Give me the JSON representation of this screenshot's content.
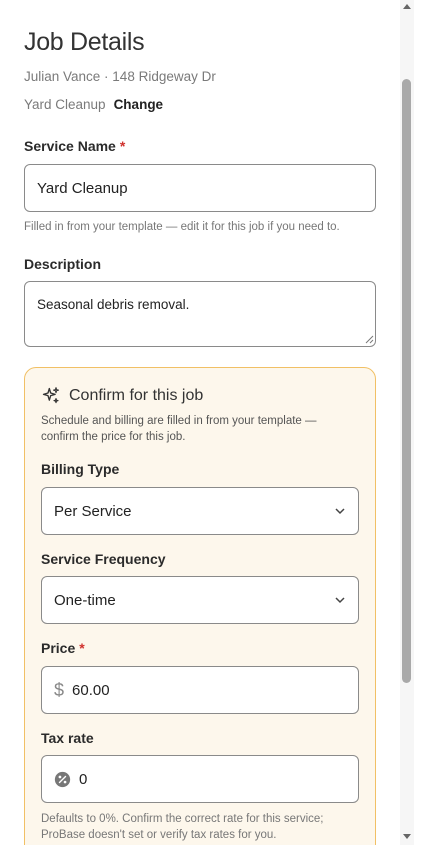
{
  "header": {
    "title": "Job Details",
    "client_line": "Julian Vance · 148 Ridgeway Dr",
    "service": "Yard Cleanup",
    "change_label": "Change"
  },
  "form": {
    "service_name": {
      "label": "Service Name",
      "required_mark": "*",
      "value": "Yard Cleanup",
      "hint": "Filled in from your template — edit it for this job if you need to."
    },
    "description": {
      "label": "Description",
      "value": "Seasonal debris removal."
    }
  },
  "confirm_card": {
    "icon": "sparkles-icon",
    "title": "Confirm for this job",
    "description": "Schedule and billing are filled in from your template — confirm the price for this job.",
    "billing_type": {
      "label": "Billing Type",
      "value": "Per Service"
    },
    "service_frequency": {
      "label": "Service Frequency",
      "value": "One-time"
    },
    "price": {
      "label": "Price",
      "required_mark": "*",
      "currency_symbol": "$",
      "value": "60.00"
    },
    "tax_rate": {
      "label": "Tax rate",
      "value": "0"
    },
    "footnote": "Defaults to 0%. Confirm the correct rate for this service; ProBase doesn't set or verify tax rates for you."
  },
  "colors": {
    "card_border": "#f1c065",
    "card_background": "#fdf7ec",
    "required": "#d0312d"
  }
}
